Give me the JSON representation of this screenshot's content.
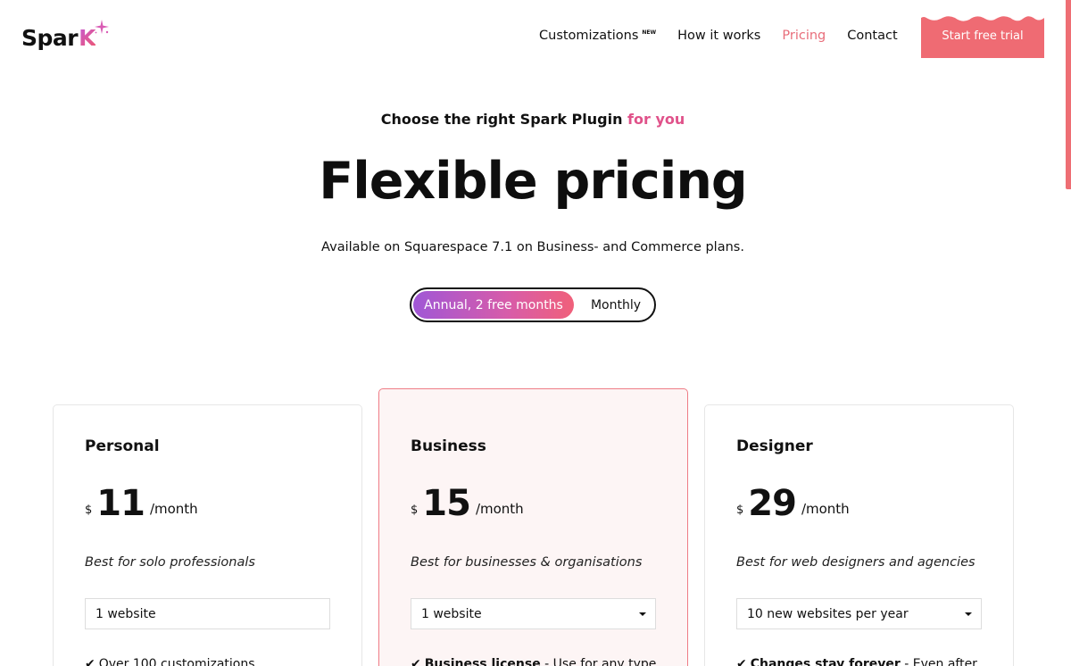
{
  "brand": {
    "logo_text": "Spar",
    "logo_accent": "K",
    "accent_color": "#ef6b73",
    "gradient_from": "#a057d6",
    "gradient_to": "#f0607a"
  },
  "nav": {
    "items": [
      {
        "label": "Customizations",
        "badge": "NEW"
      },
      {
        "label": "How it works"
      },
      {
        "label": "Pricing",
        "active": true
      },
      {
        "label": "Contact"
      }
    ],
    "cta_label": "Start free trial"
  },
  "hero": {
    "eyebrow_main": "Choose the right Spark Plugin",
    "eyebrow_accent": "for you",
    "headline": "Flexible pricing",
    "subline": "Available on Squarespace 7.1 on Business- and Commerce plans."
  },
  "billing_toggle": {
    "annual_label": "Annual, 2 free months",
    "monthly_label": "Monthly",
    "selected": "annual"
  },
  "plans": [
    {
      "name": "Personal",
      "currency": "$",
      "amount": "11",
      "period": "/month",
      "description": "Best for solo professionals",
      "select_value": "1 website",
      "has_dropdown": false,
      "feature_bold": "",
      "feature_text": "Over 100 customizations"
    },
    {
      "name": "Business",
      "currency": "$",
      "amount": "15",
      "period": "/month",
      "description": "Best for businesses & organisations",
      "select_value": "1 website",
      "has_dropdown": true,
      "feature_bold": "Business license",
      "feature_text": " - Use for any type"
    },
    {
      "name": "Designer",
      "currency": "$",
      "amount": "29",
      "period": "/month",
      "description": "Best for web designers and agencies",
      "select_value": "10 new websites per year",
      "has_dropdown": true,
      "feature_bold": "Changes stay forever",
      "feature_text": " - Even after"
    }
  ]
}
